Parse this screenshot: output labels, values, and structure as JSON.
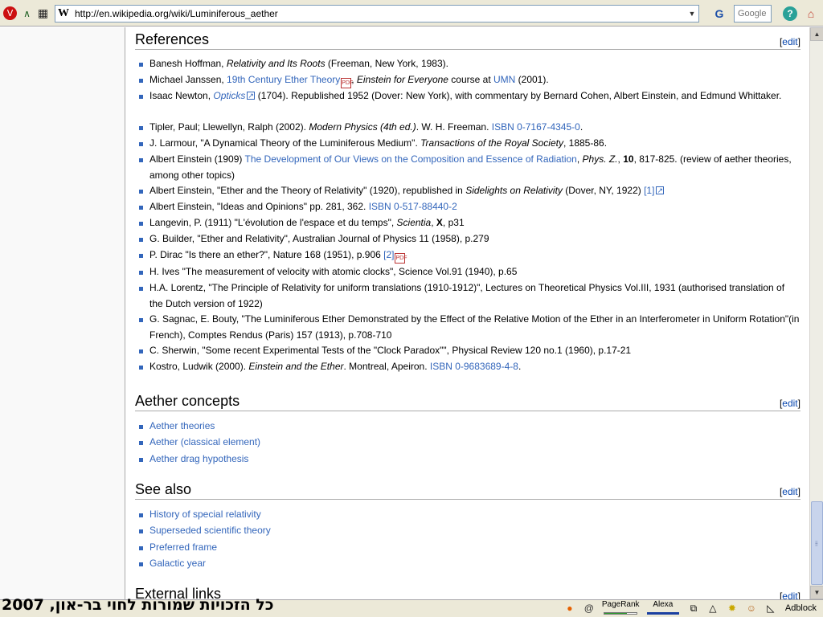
{
  "toolbar": {
    "url": "http://en.wikipedia.org/wiki/Luminiferous_aether",
    "site_logo": "W",
    "search_placeholder": "Google",
    "icons": [
      "opera-icon",
      "stats-icon",
      "grid-icon",
      "search-engine-icon",
      "help-icon",
      "home-icon"
    ]
  },
  "references": {
    "title": "References",
    "edit": "edit",
    "items": [
      {
        "parts": [
          {
            "t": "Banesh Hoffman, "
          },
          {
            "t": "Relativity and Its Roots",
            "i": true
          },
          {
            "t": " (Freeman, New York, 1983)."
          }
        ]
      },
      {
        "parts": [
          {
            "t": "Michael Janssen, "
          },
          {
            "t": "19th Century Ether Theory",
            "l": true
          },
          {
            "pdf": true
          },
          {
            "t": ", "
          },
          {
            "t": "Einstein for Everyone",
            "i": true
          },
          {
            "t": " course at "
          },
          {
            "t": "UMN",
            "l": true
          },
          {
            "t": " (2001)."
          }
        ]
      },
      {
        "parts": [
          {
            "t": "Isaac Newton, "
          },
          {
            "t": "Opticks",
            "l": true,
            "i": true
          },
          {
            "ext": true
          },
          {
            "t": " (1704). Republished 1952 (Dover: New York), with commentary by Bernard Cohen, Albert Einstein, and Edmund Whittaker."
          }
        ]
      },
      {
        "parts": [
          {
            "t": "Tipler, Paul; Llewellyn, Ralph (2002). "
          },
          {
            "t": "Modern Physics (4th ed.)",
            "i": true
          },
          {
            "t": ". W. H. Freeman. "
          },
          {
            "t": "ISBN 0-7167-4345-0",
            "l": true
          },
          {
            "t": "."
          }
        ]
      },
      {
        "parts": [
          {
            "t": "J. Larmour, \"A Dynamical Theory of the Luminiferous Medium\". "
          },
          {
            "t": "Transactions of the Royal Society",
            "i": true
          },
          {
            "t": ", 1885-86."
          }
        ]
      },
      {
        "parts": [
          {
            "t": "Albert Einstein (1909) "
          },
          {
            "t": "The Development of Our Views on the Composition and Essence of Radiation",
            "l": true
          },
          {
            "t": ", "
          },
          {
            "t": "Phys. Z.",
            "i": true
          },
          {
            "t": ", "
          },
          {
            "t": "10",
            "b": true
          },
          {
            "t": ", 817-825. (review of aether theories, among other topics)"
          }
        ]
      },
      {
        "parts": [
          {
            "t": "Albert Einstein, \"Ether and the Theory of Relativity\" (1920), republished in "
          },
          {
            "t": "Sidelights on Relativity",
            "i": true
          },
          {
            "t": " (Dover, NY, 1922) "
          },
          {
            "t": "[1]",
            "l": true
          },
          {
            "ext": true
          }
        ]
      },
      {
        "parts": [
          {
            "t": "Albert Einstein, \"Ideas and Opinions\" pp. 281, 362. "
          },
          {
            "t": "ISBN 0-517-88440-2",
            "l": true
          }
        ]
      },
      {
        "parts": [
          {
            "t": "Langevin, P. (1911) \"L'évolution de l'espace et du temps\", "
          },
          {
            "t": "Scientia",
            "i": true
          },
          {
            "t": ", "
          },
          {
            "t": "X",
            "b": true
          },
          {
            "t": ", p31"
          }
        ]
      },
      {
        "parts": [
          {
            "t": "G. Builder, \"Ether and Relativity\", Australian Journal of Physics 11 (1958), p.279"
          }
        ]
      },
      {
        "parts": [
          {
            "t": "P. Dirac \"Is there an ether?\", Nature 168 (1951), p.906 "
          },
          {
            "t": "[2]",
            "l": true
          },
          {
            "pdf": true
          }
        ]
      },
      {
        "parts": [
          {
            "t": "H. Ives \"The measurement of velocity with atomic clocks\", Science Vol.91 (1940), p.65"
          }
        ]
      },
      {
        "parts": [
          {
            "t": "H.A. Lorentz, \"The Principle of Relativity for uniform translations (1910-1912)\", Lectures on Theoretical Physics Vol.III, 1931 (authorised translation of the Dutch version of 1922)"
          }
        ]
      },
      {
        "parts": [
          {
            "t": "G. Sagnac, E. Bouty, \"The Luminiferous Ether Demonstrated by the Effect of the Relative Motion of the Ether in an Interferometer in Uniform Rotation\"(in French), Comptes Rendus (Paris) 157 (1913), p.708-710"
          }
        ]
      },
      {
        "parts": [
          {
            "t": "C. Sherwin, \"Some recent Experimental Tests of the \"Clock Paradox\"\", Physical Review 120 no.1 (1960), p.17-21"
          }
        ]
      },
      {
        "parts": [
          {
            "t": "Kostro, Ludwik (2000). "
          },
          {
            "t": "Einstein and the Ether",
            "i": true
          },
          {
            "t": ". Montreal, Apeiron. "
          },
          {
            "t": "ISBN 0-9683689-4-8",
            "l": true
          },
          {
            "t": "."
          }
        ]
      }
    ]
  },
  "concepts": {
    "title": "Aether concepts",
    "edit": "edit",
    "items": [
      "Aether theories",
      "Aether (classical element)",
      "Aether drag hypothesis"
    ]
  },
  "seealso": {
    "title": "See also",
    "edit": "edit",
    "items": [
      "History of special relativity",
      "Superseded scientific theory",
      "Preferred frame",
      "Galactic year"
    ]
  },
  "external": {
    "title": "External links",
    "edit": "edit"
  },
  "statusbar": {
    "overlay": "כל הזכויות שמורות לחוי בר-און, 2007",
    "pagerank_label": "PageRank",
    "pagerank_fraction": 0.7,
    "alexa_label": "Alexa",
    "adblock": "Adblock"
  }
}
